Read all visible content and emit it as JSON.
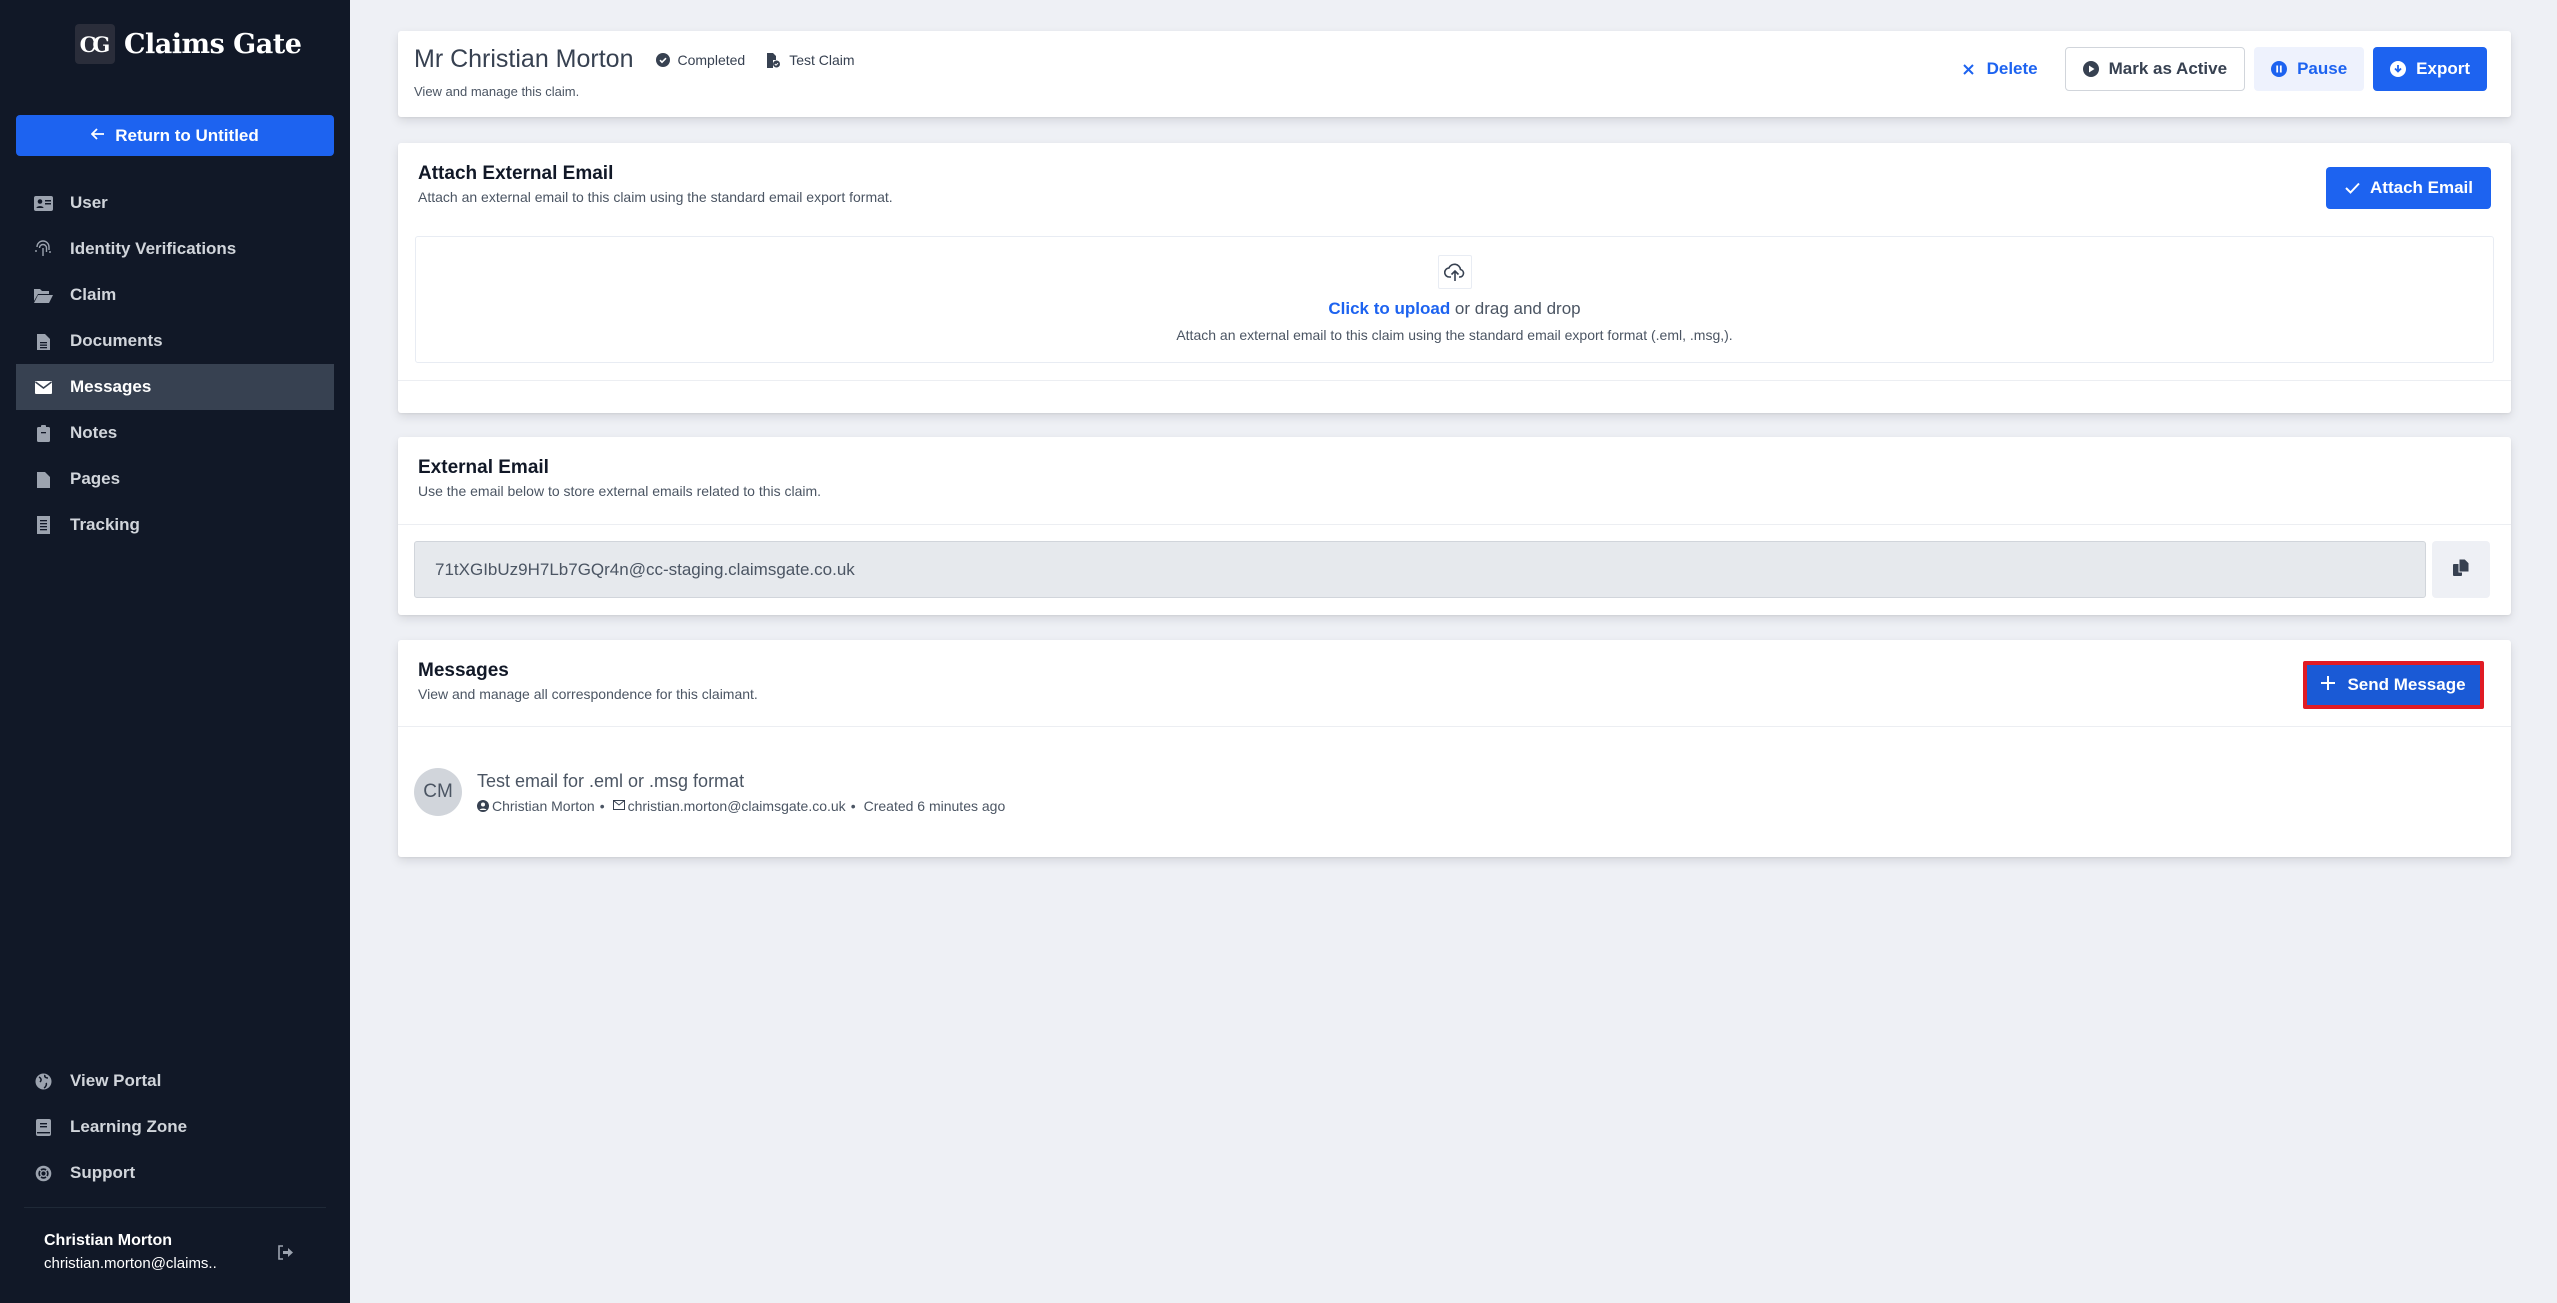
{
  "sidebar": {
    "logo_mark": "CG",
    "logo_text": "Claims Gate",
    "return_button": "Return to Untitled",
    "nav_items": [
      {
        "label": "User",
        "icon": "id-card-icon"
      },
      {
        "label": "Identity Verifications",
        "icon": "fingerprint-icon"
      },
      {
        "label": "Claim",
        "icon": "folder-open-icon"
      },
      {
        "label": "Documents",
        "icon": "file-lines-icon"
      },
      {
        "label": "Messages",
        "icon": "envelope-icon",
        "active": true
      },
      {
        "label": "Notes",
        "icon": "clipboard-icon"
      },
      {
        "label": "Pages",
        "icon": "file-icon"
      },
      {
        "label": "Tracking",
        "icon": "receipt-icon"
      }
    ],
    "bottom_items": [
      {
        "label": "View Portal",
        "icon": "globe-icon"
      },
      {
        "label": "Learning Zone",
        "icon": "book-icon"
      },
      {
        "label": "Support",
        "icon": "life-ring-icon"
      }
    ],
    "user": {
      "name": "Christian Morton",
      "email": "christian.morton@claims.."
    }
  },
  "header": {
    "title": "Mr Christian Morton",
    "status": "Completed",
    "claim_type": "Test Claim",
    "subtitle": "View and manage this claim.",
    "actions": {
      "delete": "Delete",
      "mark_active": "Mark as Active",
      "pause": "Pause",
      "export": "Export"
    }
  },
  "attach_email": {
    "title": "Attach External Email",
    "subtitle": "Attach an external email to this claim using the standard email export format.",
    "button": "Attach Email",
    "upload_link": "Click to upload",
    "upload_text": " or drag and drop",
    "upload_hint": "Attach an external email to this claim using the standard email export format (.eml, .msg,)."
  },
  "external_email": {
    "title": "External Email",
    "subtitle": "Use the email below to store external emails related to this claim.",
    "address": "71tXGIbUz9H7Lb7GQr4n@cc-staging.claimsgate.co.uk"
  },
  "messages": {
    "title": "Messages",
    "subtitle": "View and manage all correspondence for this claimant.",
    "send_button": "Send Message",
    "items": [
      {
        "initials": "CM",
        "subject": "Test email for .eml or .msg format",
        "sender": "Christian Morton",
        "email": "christian.morton@claimsgate.co.uk",
        "created": "Created 6 minutes ago"
      }
    ]
  },
  "colors": {
    "primary": "#1d63f0",
    "sidebar_bg": "#111827",
    "sidebar_active": "#374151",
    "highlight_border": "#e01b24"
  }
}
